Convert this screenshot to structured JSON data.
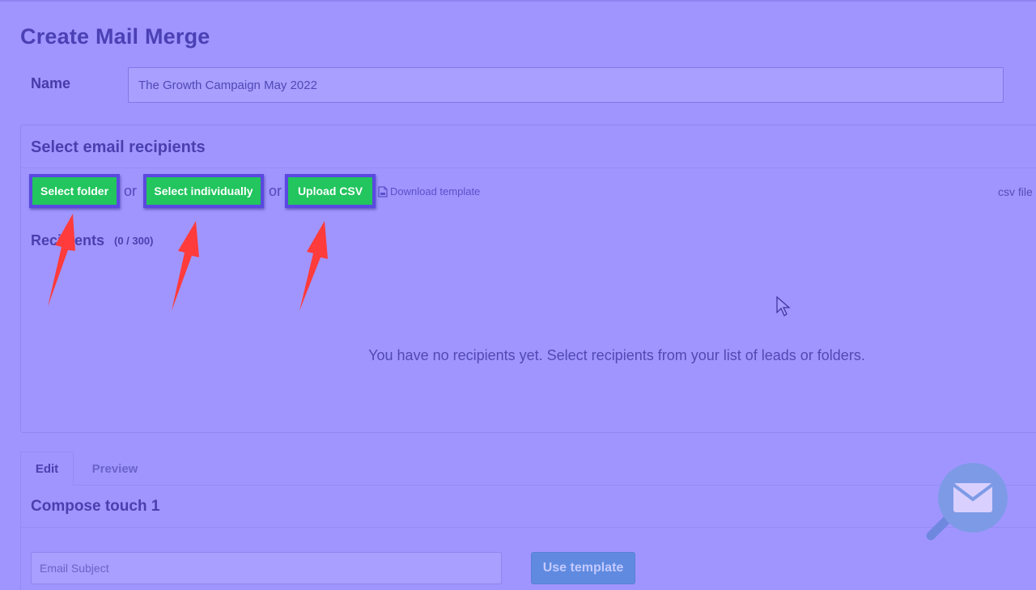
{
  "page": {
    "title": "Create Mail Merge"
  },
  "name_field": {
    "label": "Name",
    "value": "The Growth Campaign May 2022"
  },
  "recipients_section": {
    "heading": "Select email recipients",
    "buttons": {
      "select_folder": "Select folder",
      "select_individually": "Select individually",
      "upload_csv": "Upload CSV"
    },
    "or_text": "or",
    "download_template": "Download template",
    "csv_note": "csv file",
    "recipients_label": "Recipients",
    "recipients_count": "(0 / 300)",
    "empty_message": "You have no recipients yet. Select recipients from your list of leads or folders."
  },
  "tabs": [
    {
      "label": "Edit",
      "active": true
    },
    {
      "label": "Preview",
      "active": false
    }
  ],
  "compose": {
    "heading": "Compose touch 1",
    "subject_placeholder": "Email Subject",
    "use_template_label": "Use template"
  },
  "colors": {
    "overlay": "#a095ff",
    "button_green": "#22c55e",
    "highlight_border": "#5a49e0",
    "arrow_red": "#ff3b3b"
  },
  "icons": [
    "file-icon",
    "mail-icon",
    "magnifier-icon",
    "cursor-icon",
    "arrow-icon"
  ]
}
